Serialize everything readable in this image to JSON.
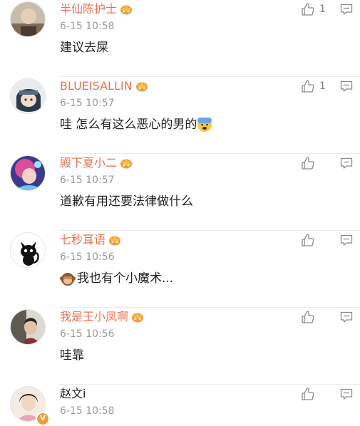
{
  "comments": [
    {
      "username": "半仙陈护士",
      "time": "6-15 10:58",
      "text": "建议去屎",
      "likes": "1",
      "avatar": "photo-avatar",
      "badge": "crown-badge-icon",
      "emoji": ""
    },
    {
      "username": "BLUEISALLIN",
      "time": "6-15 10:57",
      "text": "哇 怎么有这么恶心的男的",
      "likes": "1",
      "avatar": "anime-avatar",
      "badge": "crown-badge-icon",
      "emoji": "fearful-face-emoji"
    },
    {
      "username": "殿下夏小二",
      "time": "6-15 10:57",
      "text": "道歉有用还要法律做什么",
      "likes": "",
      "avatar": "game-character-avatar",
      "badge": "crown-badge-icon",
      "emoji": ""
    },
    {
      "username": "七秒耳语",
      "time": "6-15 10:56",
      "text": "我也有个小魔术...",
      "likes": "",
      "avatar": "black-cat-avatar",
      "badge": "crown-badge-icon",
      "emoji": "monkey-emoji"
    },
    {
      "username": "我是王小凤啊",
      "time": "6-15 10:56",
      "text": "哇靠",
      "likes": "",
      "avatar": "photo-avatar",
      "badge": "crown-badge-icon",
      "emoji": ""
    },
    {
      "username": "赵文i",
      "time": "6-15 10:58",
      "text": "",
      "likes": "",
      "avatar": "photo-avatar",
      "badge": "verified-badge-icon",
      "emoji": ""
    }
  ],
  "colors": {
    "username": "#eb7350",
    "time": "#9a9a9a",
    "icon": "#8a8a8a",
    "vip": "#f29d38"
  }
}
